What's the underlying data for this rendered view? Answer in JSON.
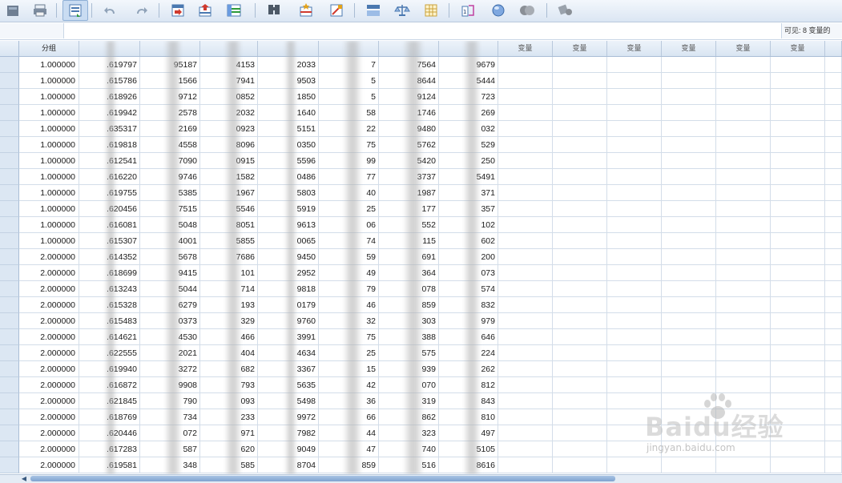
{
  "colors": {
    "toolbar_bg": "#dbe6f3",
    "header_bg": "#d9e5f2",
    "row_number_bg": "#dce7f3",
    "grid_line": "#d3dde9",
    "scroll_thumb": "#7fa3cf"
  },
  "toolbar": {
    "buttons": [
      {
        "name": "open-data-icon"
      },
      {
        "name": "print-icon"
      },
      {
        "name": "recall-dialog-icon",
        "pressed": true
      },
      {
        "name": "undo-icon"
      },
      {
        "name": "redo-icon"
      },
      {
        "name": "go-to-case-icon"
      },
      {
        "name": "go-to-variable-icon"
      },
      {
        "name": "variables-icon"
      },
      {
        "name": "find-icon"
      },
      {
        "name": "insert-cases-icon"
      },
      {
        "name": "insert-variable-icon"
      },
      {
        "name": "split-file-icon"
      },
      {
        "name": "weight-cases-icon"
      },
      {
        "name": "select-cases-icon"
      },
      {
        "name": "value-labels-icon"
      },
      {
        "name": "use-variable-sets-icon"
      },
      {
        "name": "show-all-variables-icon"
      },
      {
        "name": "spelling-icon"
      }
    ]
  },
  "editbar": {
    "cell_reference": "",
    "cell_value": "",
    "visible_info": "可见: 8 变量的"
  },
  "grid": {
    "columns": [
      "分组",
      "",
      "",
      "",
      "",
      "",
      "",
      "",
      "变量",
      "变量",
      "变量",
      "变量",
      "变量",
      "变量"
    ],
    "rows": [
      [
        "1.000000",
        ".619797",
        "95187",
        "4153",
        "2033",
        "7",
        "7564",
        "9679"
      ],
      [
        "1.000000",
        ".615786",
        "1566",
        "7941",
        "9503",
        "5",
        "8644",
        "5444"
      ],
      [
        "1.000000",
        ".618926",
        "9712",
        "0852",
        "1850",
        "5",
        "9124",
        "723"
      ],
      [
        "1.000000",
        ".619942",
        "2578",
        "2032",
        "1640",
        "58",
        "1746",
        "269"
      ],
      [
        "1.000000",
        ".635317",
        "2169",
        "0923",
        "5151",
        "22",
        "9480",
        "032"
      ],
      [
        "1.000000",
        ".619818",
        "4558",
        "8096",
        "0350",
        "75",
        "5762",
        "529"
      ],
      [
        "1.000000",
        ".612541",
        "7090",
        "0915",
        "5596",
        "99",
        "5420",
        "250"
      ],
      [
        "1.000000",
        ".616220",
        "9746",
        "1582",
        "0486",
        "77",
        "3737",
        "5491"
      ],
      [
        "1.000000",
        ".619755",
        "5385",
        "1967",
        "5803",
        "40",
        "1987",
        "371"
      ],
      [
        "1.000000",
        ".620456",
        "7515",
        "5546",
        "5919",
        "25",
        "177",
        "357"
      ],
      [
        "1.000000",
        ".616081",
        "5048",
        "8051",
        "9613",
        "06",
        "552",
        "102"
      ],
      [
        "1.000000",
        ".615307",
        "4001",
        "5855",
        "0065",
        "74",
        "115",
        "602"
      ],
      [
        "2.000000",
        ".614352",
        "5678",
        "7686",
        "9450",
        "59",
        "691",
        "200"
      ],
      [
        "2.000000",
        ".618699",
        "9415",
        "101",
        "2952",
        "49",
        "364",
        "073"
      ],
      [
        "2.000000",
        ".613243",
        "5044",
        "714",
        "9818",
        "79",
        "078",
        "574"
      ],
      [
        "2.000000",
        ".615328",
        "6279",
        "193",
        "0179",
        "46",
        "859",
        "832"
      ],
      [
        "2.000000",
        ".615483",
        "0373",
        "329",
        "9760",
        "32",
        "303",
        "979"
      ],
      [
        "2.000000",
        ".614621",
        "4530",
        "466",
        "3991",
        "75",
        "388",
        "646"
      ],
      [
        "2.000000",
        ".622555",
        "2021",
        "404",
        "4634",
        "25",
        "575",
        "224"
      ],
      [
        "2.000000",
        ".619940",
        "3272",
        "682",
        "3367",
        "15",
        "939",
        "262"
      ],
      [
        "2.000000",
        ".616872",
        "9908",
        "793",
        "5635",
        "42",
        "070",
        "812"
      ],
      [
        "2.000000",
        ".621845",
        "790",
        "093",
        "5498",
        "36",
        "319",
        "843"
      ],
      [
        "2.000000",
        ".618769",
        "734",
        "233",
        "9972",
        "66",
        "862",
        "810"
      ],
      [
        "2.000000",
        ".620446",
        "072",
        "971",
        "7982",
        "44",
        "323",
        "497"
      ],
      [
        "2.000000",
        ".617283",
        "587",
        "620",
        "9049",
        "47",
        "740",
        "5105"
      ],
      [
        "2.000000",
        ".619581",
        "348",
        "585",
        "8704",
        "859",
        "516",
        "8616"
      ]
    ]
  },
  "watermark": {
    "logo_text": "Baidu经验",
    "url": "jingyan.baidu.com"
  }
}
